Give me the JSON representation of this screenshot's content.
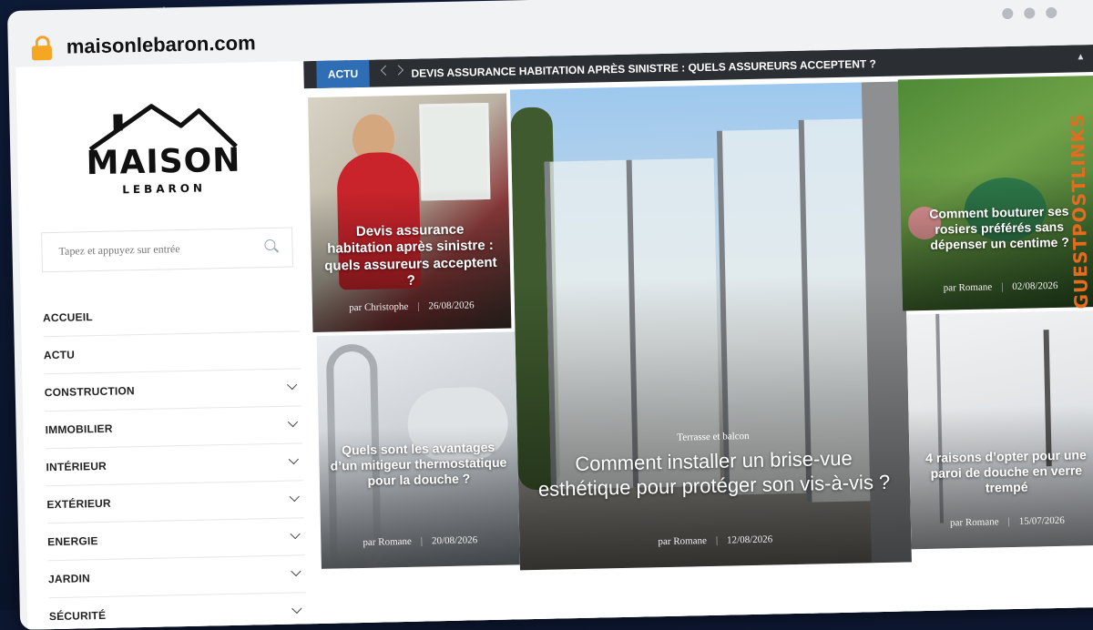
{
  "browser": {
    "url": "maisonlebaron.com"
  },
  "logo": {
    "main": "MAISON",
    "sub": "LEBARON"
  },
  "search": {
    "placeholder": "Tapez et appuyez sur entrée"
  },
  "menu": [
    {
      "label": "ACCUEIL",
      "has_children": false
    },
    {
      "label": "ACTU",
      "has_children": false
    },
    {
      "label": "CONSTRUCTION",
      "has_children": true
    },
    {
      "label": "IMMOBILIER",
      "has_children": true
    },
    {
      "label": "INTÉRIEUR",
      "has_children": true
    },
    {
      "label": "EXTÉRIEUR",
      "has_children": true
    },
    {
      "label": "ENERGIE",
      "has_children": true
    },
    {
      "label": "JARDIN",
      "has_children": true
    },
    {
      "label": "SÉCURITÉ",
      "has_children": true
    }
  ],
  "ticker": {
    "tag": "ACTU",
    "headline": "DEVIS ASSURANCE HABITATION APRÈS SINISTRE : QUELS ASSUREURS ACCEPTENT ?"
  },
  "articles": [
    {
      "title": "Devis assurance habitation après sinistre : quels assureurs acceptent ?",
      "author": "par Christophe",
      "date": "26/08/2026"
    },
    {
      "title": "Quels sont les avantages d’un mitigeur thermostatique pour la douche ?",
      "author": "par Romane",
      "date": "20/08/2026"
    },
    {
      "category": "Terrasse et balcon",
      "title": "Comment installer un brise-vue esthétique pour protéger son vis-à-vis ?",
      "author": "par Romane",
      "date": "12/08/2026"
    },
    {
      "title": "Comment bouturer ses rosiers préférés sans dépenser un centime ?",
      "author": "par Romane",
      "date": "02/08/2026"
    },
    {
      "title": "4 raisons d’opter pour une paroi de douche en verre trempé",
      "author": "par Romane",
      "date": "15/07/2026"
    }
  ],
  "watermark": {
    "text": "GUESTPOSTLINKS"
  },
  "colors": {
    "accent": "#2f6db5",
    "ticker_bg": "#2b2e33",
    "lock": "#f5a623",
    "watermark": "#e56b1f"
  }
}
